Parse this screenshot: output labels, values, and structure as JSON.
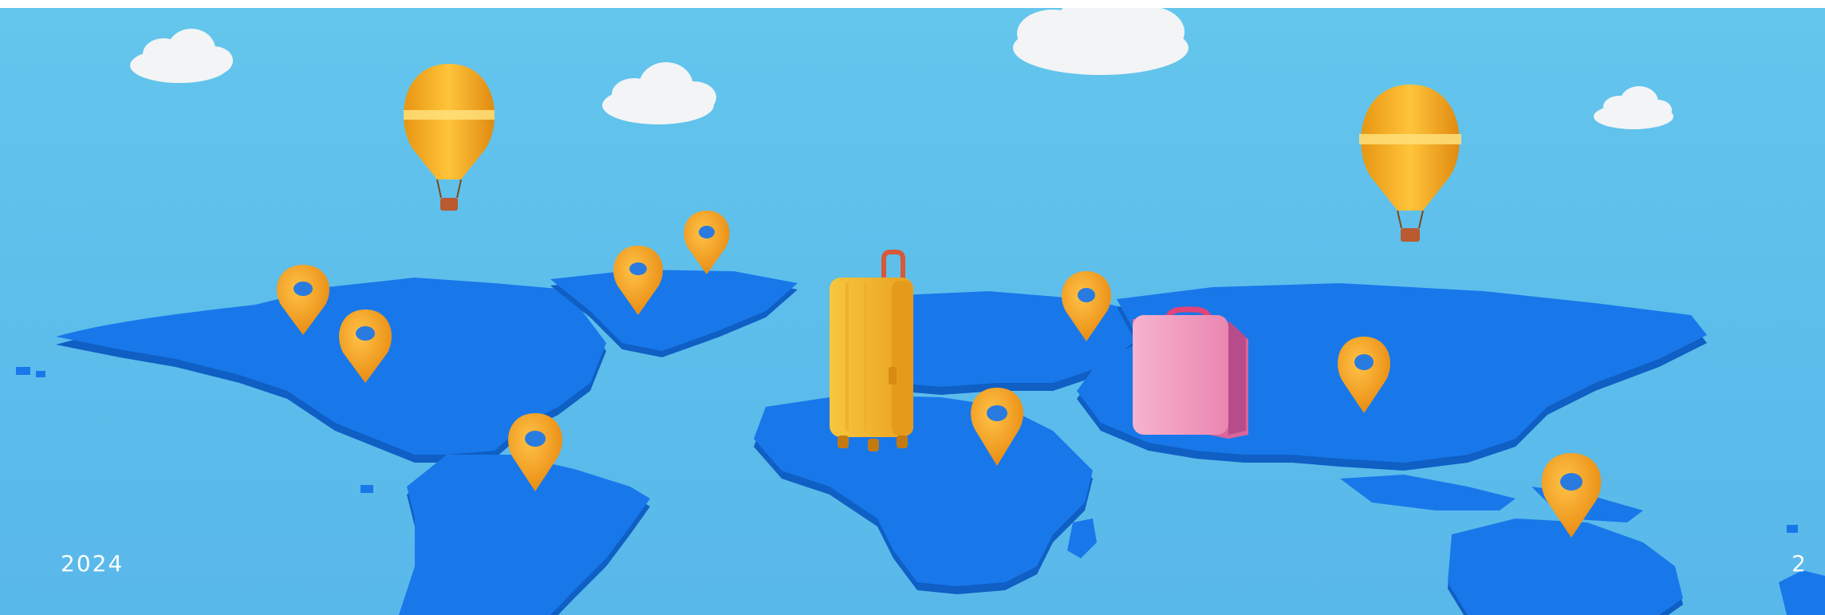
{
  "slide": {
    "year": "2024",
    "page_number": "2"
  },
  "scene": {
    "icons": [
      "cloud-icon",
      "hot-air-balloon-icon",
      "map-pin-icon",
      "suitcase-icon",
      "world-map-icon"
    ],
    "colors": {
      "sky": "#5cbdeb",
      "continent": "#1878ea",
      "continent_shadow": "#0f5fc4",
      "pin": "#f2a020",
      "balloon": "#f7b21c",
      "yellow_suitcase": "#f6b92a",
      "pink_suitcase": "#f29ac0"
    }
  }
}
